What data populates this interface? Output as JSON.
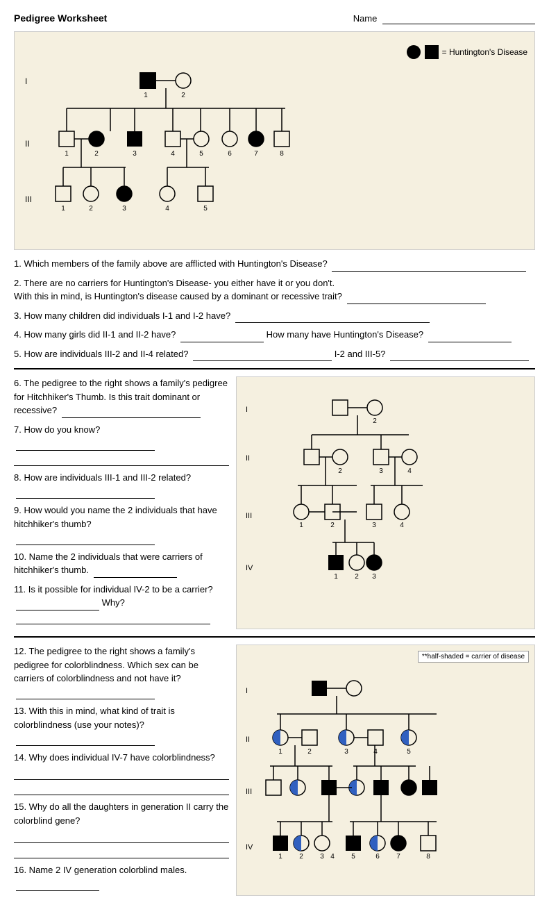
{
  "header": {
    "title": "Pedigree Worksheet",
    "name_label": "Name"
  },
  "questions": {
    "q1": "1. Which members of the family above are afflicted with Huntington's Disease?",
    "q2a": "2. There are no carriers for Huntington's Disease- you either have it or you don't.",
    "q2b": "With this in mind, is Huntington's disease caused by a dominant or recessive trait?",
    "q3": "3. How many children did individuals I-1 and I-2 have?",
    "q4a": "4. How many girls did II-1 and II-2 have?",
    "q4b": "How many have Huntington's Disease?",
    "q5a": "5. How are individuals III-2 and II-4 related?",
    "q5b": "I-2 and III-5?",
    "q6": "6. The pedigree to the right shows a family's pedigree for Hitchhiker's Thumb. Is this trait dominant or recessive?",
    "q7": "7. How do you know?",
    "q8": "8. How are individuals III-1 and III-2 related?",
    "q9": "9. How would you name the 2 individuals that have hitchhiker's thumb?",
    "q10": "10. Name the 2 individuals that were carriers of hitchhiker's thumb.",
    "q11a": "11. Is it possible for individual IV-2 to be a carrier?",
    "q11b": "Why?",
    "q12": "12. The pedigree to the right shows a family's pedigree for colorblindness.  Which sex can be carriers of colorblindness and not have it?",
    "q13": "13. With this in mind, what kind of trait is colorblindness (use your notes)?",
    "q14": "14. Why does individual IV-7 have colorblindness?",
    "q15": "15. Why do all the daughters in generation II carry the colorblind gene?",
    "q16": "16. Name 2 IV generation colorblind males.",
    "legend": "= Huntington's Disease",
    "legend2": "**half-shaded = carrier of disease"
  }
}
